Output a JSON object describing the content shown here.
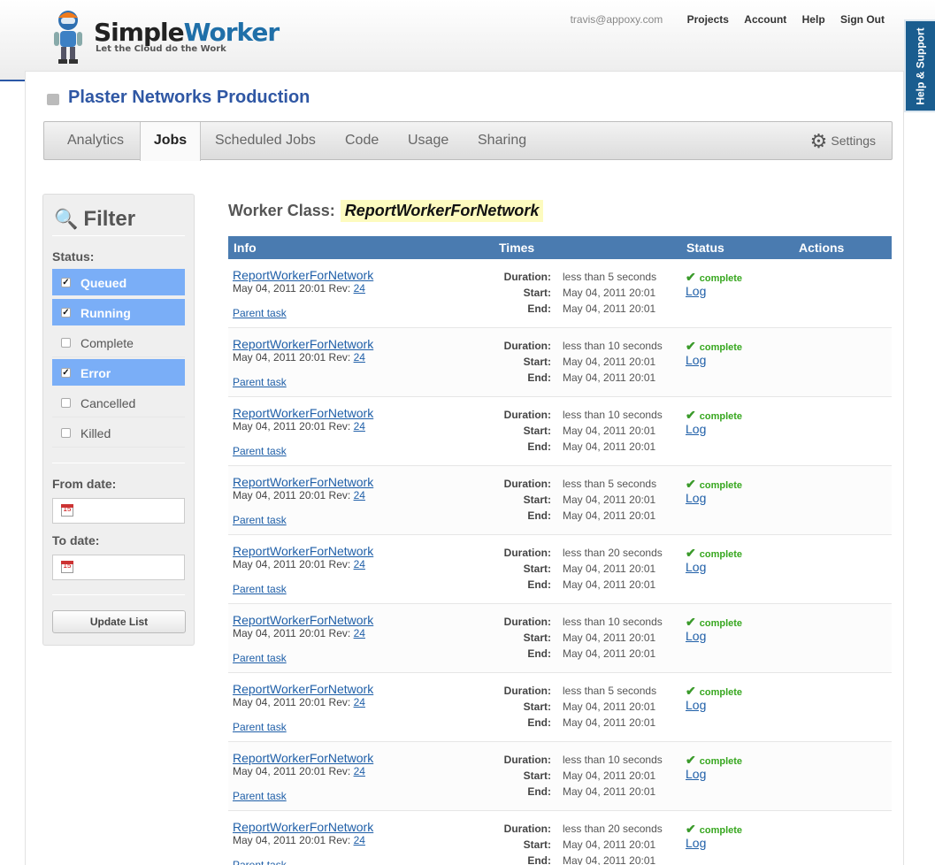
{
  "header": {
    "brand_primary": "Simple",
    "brand_secondary": "Worker",
    "tagline": "Let the Cloud do the Work",
    "user_email": "travis@appoxy.com",
    "nav": [
      "Projects",
      "Account",
      "Help",
      "Sign Out"
    ],
    "help_tab": "Help & Support"
  },
  "project": {
    "title": "Plaster Networks Production"
  },
  "tabs": [
    "Analytics",
    "Jobs",
    "Scheduled Jobs",
    "Code",
    "Usage",
    "Sharing"
  ],
  "active_tab": "Jobs",
  "settings_label": "Settings",
  "filter": {
    "title": "Filter",
    "status_label": "Status:",
    "statuses": [
      {
        "label": "Queued",
        "checked": true
      },
      {
        "label": "Running",
        "checked": true
      },
      {
        "label": "Complete",
        "checked": false
      },
      {
        "label": "Error",
        "checked": true
      },
      {
        "label": "Cancelled",
        "checked": false
      },
      {
        "label": "Killed",
        "checked": false
      }
    ],
    "from_label": "From date:",
    "to_label": "To date:",
    "calendar_glyph": "15",
    "update_button": "Update List"
  },
  "worker": {
    "label": "Worker Class:",
    "value": "ReportWorkerForNetwork"
  },
  "table": {
    "columns": [
      "Info",
      "Times",
      "Status",
      "Actions"
    ],
    "duration_label": "Duration:",
    "start_label": "Start:",
    "end_label": "End:",
    "rev_label": "Rev:",
    "parent_label": "Parent task",
    "log_label": "Log",
    "rows": [
      {
        "name": "ReportWorkerForNetwork",
        "created": "May 04, 2011 20:01",
        "rev": "24",
        "duration": "less than 5 seconds",
        "start": "May 04, 2011 20:01",
        "end": "May 04, 2011 20:01",
        "status": "complete"
      },
      {
        "name": "ReportWorkerForNetwork",
        "created": "May 04, 2011 20:01",
        "rev": "24",
        "duration": "less than 10 seconds",
        "start": "May 04, 2011 20:01",
        "end": "May 04, 2011 20:01",
        "status": "complete"
      },
      {
        "name": "ReportWorkerForNetwork",
        "created": "May 04, 2011 20:01",
        "rev": "24",
        "duration": "less than 10 seconds",
        "start": "May 04, 2011 20:01",
        "end": "May 04, 2011 20:01",
        "status": "complete"
      },
      {
        "name": "ReportWorkerForNetwork",
        "created": "May 04, 2011 20:01",
        "rev": "24",
        "duration": "less than 5 seconds",
        "start": "May 04, 2011 20:01",
        "end": "May 04, 2011 20:01",
        "status": "complete"
      },
      {
        "name": "ReportWorkerForNetwork",
        "created": "May 04, 2011 20:01",
        "rev": "24",
        "duration": "less than 20 seconds",
        "start": "May 04, 2011 20:01",
        "end": "May 04, 2011 20:01",
        "status": "complete"
      },
      {
        "name": "ReportWorkerForNetwork",
        "created": "May 04, 2011 20:01",
        "rev": "24",
        "duration": "less than 10 seconds",
        "start": "May 04, 2011 20:01",
        "end": "May 04, 2011 20:01",
        "status": "complete"
      },
      {
        "name": "ReportWorkerForNetwork",
        "created": "May 04, 2011 20:01",
        "rev": "24",
        "duration": "less than 5 seconds",
        "start": "May 04, 2011 20:01",
        "end": "May 04, 2011 20:01",
        "status": "complete"
      },
      {
        "name": "ReportWorkerForNetwork",
        "created": "May 04, 2011 20:01",
        "rev": "24",
        "duration": "less than 10 seconds",
        "start": "May 04, 2011 20:01",
        "end": "May 04, 2011 20:01",
        "status": "complete"
      },
      {
        "name": "ReportWorkerForNetwork",
        "created": "May 04, 2011 20:01",
        "rev": "24",
        "duration": "less than 20 seconds",
        "start": "May 04, 2011 20:01",
        "end": "May 04, 2011 20:01",
        "status": "complete"
      }
    ]
  },
  "colors": {
    "brand_blue": "#2f57a4",
    "table_header": "#4a7bb0",
    "checked_status": "#7aaef7",
    "complete_green": "#37a71f",
    "worker_highlight": "#fdfbbf"
  },
  "icons": {
    "robot": "robot-logo-icon",
    "project": "folder-icon",
    "settings": "gear-icon",
    "filter": "magnifier-icon",
    "calendar": "calendar-icon",
    "status_ok": "checkmark-icon"
  }
}
